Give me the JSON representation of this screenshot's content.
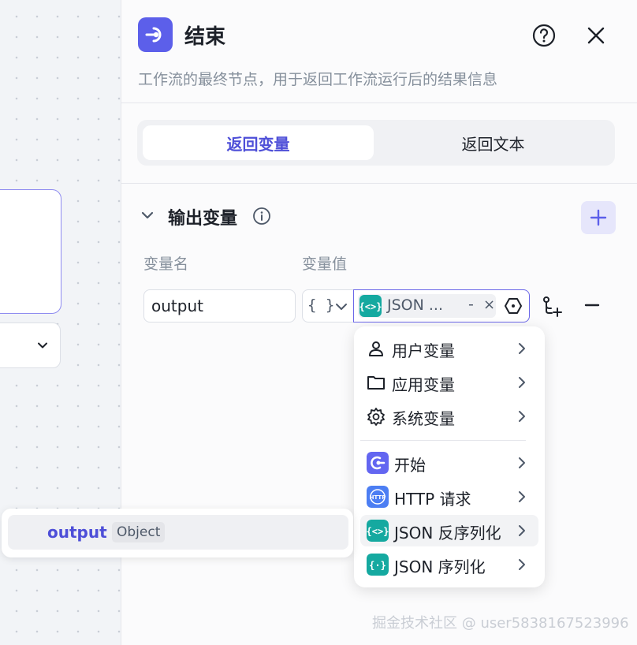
{
  "panel": {
    "title": "结束",
    "description": "工作流的最终节点，用于返回工作流运行后的结果信息",
    "tabs": [
      {
        "label": "返回变量",
        "active": true
      },
      {
        "label": "返回文本",
        "active": false
      }
    ]
  },
  "output_section": {
    "title": "输出变量",
    "col_name": "变量名",
    "col_value": "变量值",
    "rows": [
      {
        "name": "output",
        "type_symbol": "{ }",
        "reference_label": "JSON ...",
        "reference_dash": "-",
        "reference_close": "×"
      }
    ]
  },
  "variable_menu": {
    "groups": [
      {
        "label": "用户变量",
        "icon": "user-icon"
      },
      {
        "label": "应用变量",
        "icon": "folder-icon"
      },
      {
        "label": "系统变量",
        "icon": "gear-icon"
      }
    ],
    "nodes": [
      {
        "label": "开始",
        "icon": "start-node-icon",
        "color": "#6366f1"
      },
      {
        "label": "HTTP 请求",
        "icon": "http-node-icon",
        "color": "#4c7ef3"
      },
      {
        "label": "JSON 反序列化",
        "icon": "json-parse-node-icon",
        "color": "#15a9a0",
        "highlighted": true
      },
      {
        "label": "JSON 序列化",
        "icon": "json-stringify-node-icon",
        "color": "#15a9a0"
      }
    ]
  },
  "field_popover": {
    "name": "output",
    "type": "Object"
  },
  "watermark": "掘金技术社区 @ user5838167523996",
  "colors": {
    "accent": "#4e4fd8",
    "end_icon": "#5c5fea",
    "json_node": "#15a9a0"
  }
}
